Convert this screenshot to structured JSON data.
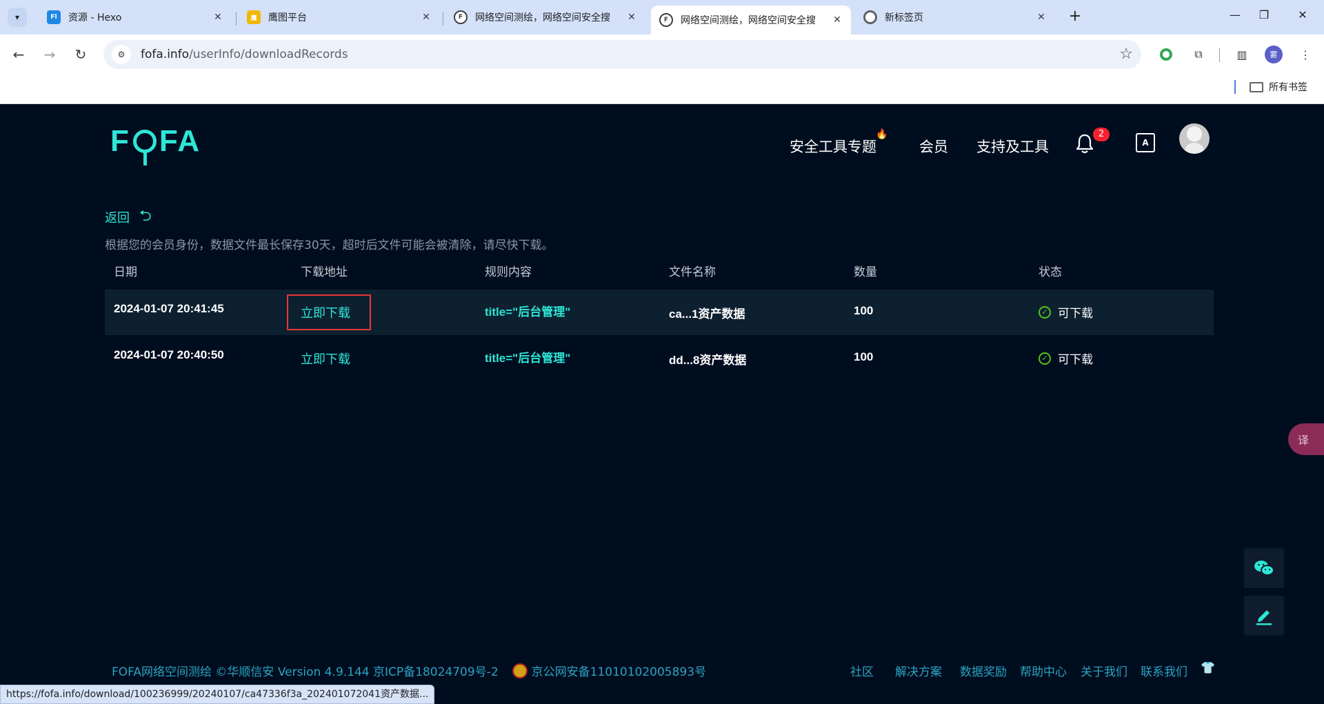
{
  "browser": {
    "tabs": [
      {
        "title": "资源 - Hexo",
        "favicon": "fluid-icon"
      },
      {
        "title": "鹰图平台",
        "favicon": "hunter-icon"
      },
      {
        "title": "网络空间测绘，网络空间安全搜",
        "favicon": "fofa-icon"
      },
      {
        "title": "网络空间测绘，网络空间安全搜",
        "favicon": "fofa-icon",
        "active": true
      },
      {
        "title": "新标签页",
        "favicon": "chrome-icon"
      }
    ],
    "url_host": "fofa.info",
    "url_path": "/userInfo/downloadRecords",
    "bookmarks_folder": "所有书签",
    "profile_initial": "雾",
    "status_url": "https://fofa.info/download/100236999/20240107/ca47336f3a_202401072041资产数据..."
  },
  "header": {
    "logo": "FOFA",
    "nav": [
      "安全工具专题",
      "会员",
      "支持及工具"
    ],
    "notification_count": "2",
    "translate_icon_text": "A"
  },
  "main": {
    "back_label": "返回",
    "notice": "根据您的会员身份，数据文件最长保存30天，超时后文件可能会被清除，请尽快下载。",
    "columns": [
      "日期",
      "下载地址",
      "规则内容",
      "文件名称",
      "数量",
      "状态"
    ],
    "rows": [
      {
        "date": "2024-01-07 20:41:45",
        "link": "立即下载",
        "rule": "title=\"后台管理\"",
        "file": "ca...1资产数据",
        "count": "100",
        "status": "可下载"
      },
      {
        "date": "2024-01-07 20:40:50",
        "link": "立即下载",
        "rule": "title=\"后台管理\"",
        "file": "dd...8资产数据",
        "count": "100",
        "status": "可下载"
      }
    ]
  },
  "footer": {
    "copyright": "FOFA网络空间测绘 ©华顺信安 Version 4.9.144 京ICP备18024709号-2",
    "police": "京公网安备11010102005893号",
    "links": [
      "社区",
      "解决方案",
      "数据奖励",
      "帮助中心",
      "关于我们",
      "联系我们"
    ]
  },
  "colors": {
    "accent": "#2ee6d6",
    "background": "#000d1f",
    "status_ok": "#52c41a",
    "highlight_box": "#e53935"
  }
}
